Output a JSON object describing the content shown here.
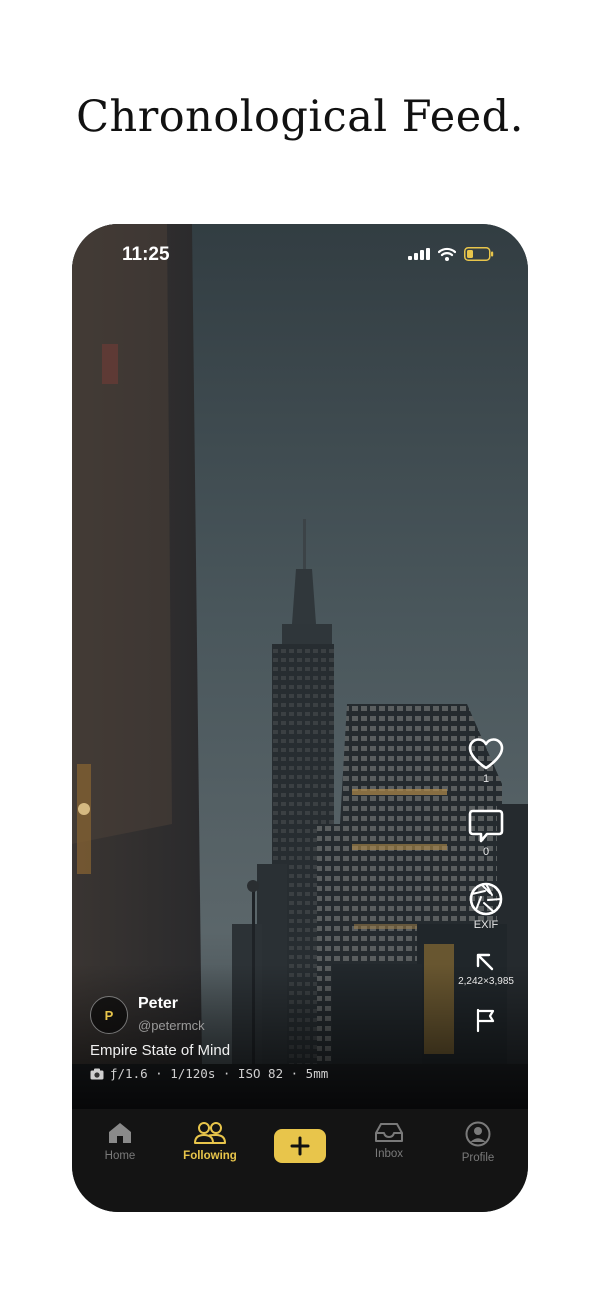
{
  "headline": "Chronological Feed.",
  "status_bar": {
    "time": "11:25"
  },
  "post": {
    "avatar_initial": "P",
    "username": "Peter",
    "handle": "@petermck",
    "caption": "Empire State of Mind",
    "exif_line": "ƒ/1.6 · 1/120s · ISO 82 · 5mm",
    "actions": {
      "like_count": "1",
      "comment_count": "0",
      "exif_label": "EXIF",
      "resolution": "2,242×3,985"
    }
  },
  "tab_bar": {
    "home": "Home",
    "following": "Following",
    "inbox": "Inbox",
    "profile": "Profile"
  },
  "colors": {
    "accent": "#e8c54b",
    "tab_bar_bg": "#141414",
    "inactive": "#7a7a7a"
  },
  "icons": [
    "signal-icon",
    "wifi-icon",
    "battery-icon",
    "heart-icon",
    "comment-icon",
    "aperture-icon",
    "expand-icon",
    "flag-icon",
    "camera-icon",
    "home-icon",
    "people-icon",
    "plus-icon",
    "inbox-icon",
    "profile-icon"
  ]
}
